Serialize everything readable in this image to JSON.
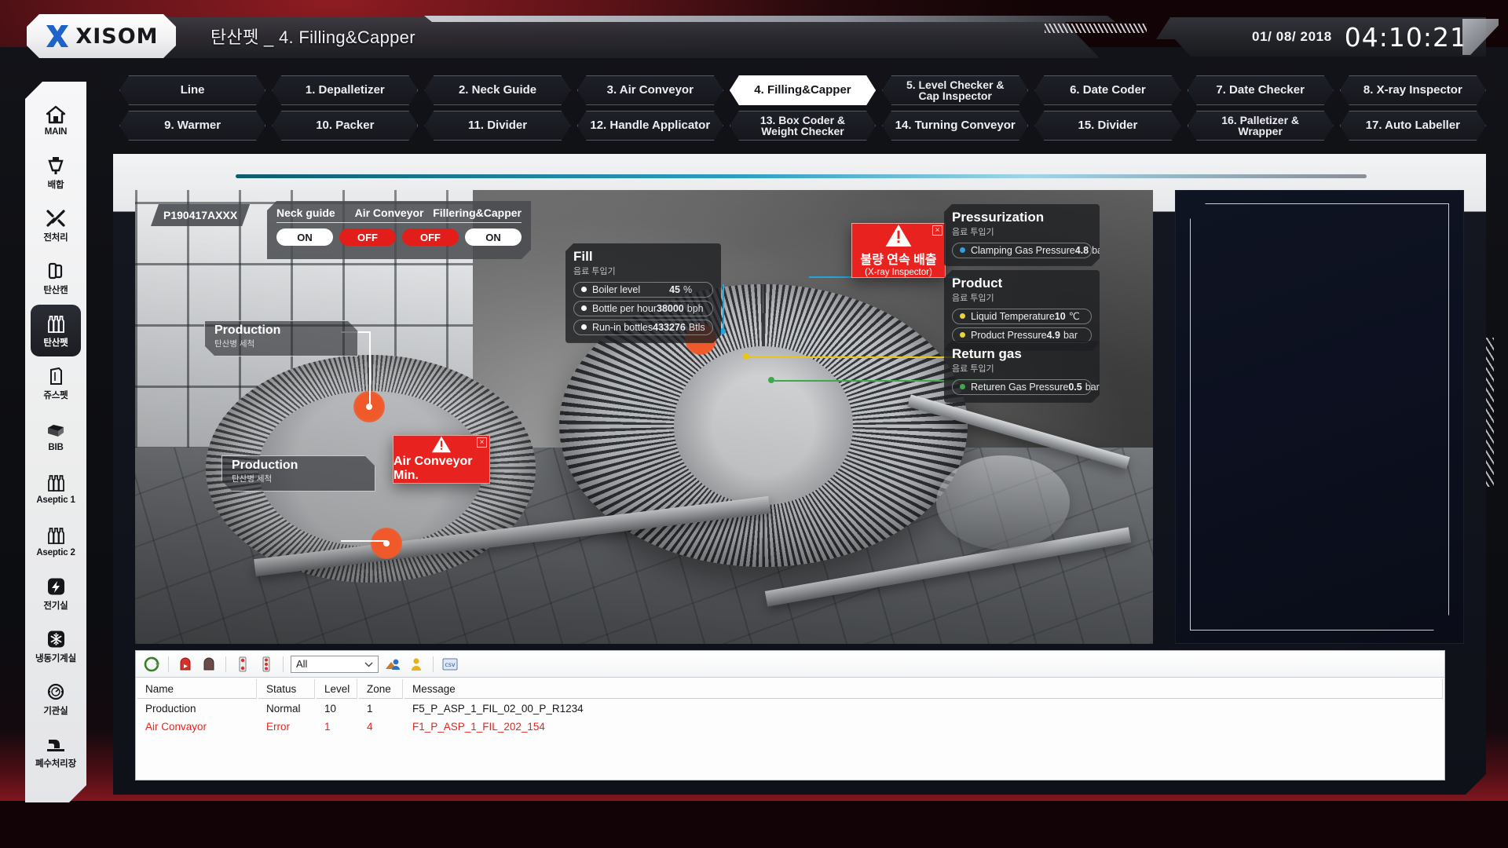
{
  "header": {
    "logo_word": "XISOM",
    "logo_icon": "x-logo-icon",
    "title": "탄산펫 _ 4. Filling&Capper",
    "date": "01/ 08/ 2018",
    "time": "04:10:21"
  },
  "sidebar": {
    "items": [
      {
        "label": "MAIN",
        "icon": "home-icon",
        "active": false
      },
      {
        "label": "배합",
        "icon": "mixer-icon",
        "active": false
      },
      {
        "label": "전처리",
        "icon": "tools-icon",
        "active": false
      },
      {
        "label": "탄산캔",
        "icon": "can-icon",
        "active": false
      },
      {
        "label": "탄산펫",
        "icon": "bottles-icon",
        "active": true
      },
      {
        "label": "쥬스펫",
        "icon": "carton-icon",
        "active": false
      },
      {
        "label": "BIB",
        "icon": "box-icon",
        "active": false
      },
      {
        "label": "Aseptic 1",
        "icon": "bottles-row-icon",
        "active": false
      },
      {
        "label": "Aseptic 2",
        "icon": "bottles-row-icon",
        "active": false
      },
      {
        "label": "전기실",
        "icon": "bolt-icon",
        "active": false
      },
      {
        "label": "냉동기계실",
        "icon": "snowflake-icon",
        "active": false
      },
      {
        "label": "기관실",
        "icon": "gauge-icon",
        "active": false
      },
      {
        "label": "폐수처리장",
        "icon": "waste-water-icon",
        "active": false
      }
    ]
  },
  "tabs": {
    "row1": [
      {
        "label": "Line",
        "active": false
      },
      {
        "label": "1. Depalletizer",
        "active": false
      },
      {
        "label": "2. Neck Guide",
        "active": false
      },
      {
        "label": "3. Air Conveyor",
        "active": false
      },
      {
        "label": "4. Filling&Capper",
        "active": true
      },
      {
        "label": "5. Level Checker &\nCap Inspector",
        "active": false
      },
      {
        "label": "6. Date Coder",
        "active": false
      },
      {
        "label": "7. Date Checker",
        "active": false
      },
      {
        "label": "8. X-ray Inspector",
        "active": false
      }
    ],
    "row2": [
      {
        "label": "9. Warmer",
        "active": false
      },
      {
        "label": "10. Packer",
        "active": false
      },
      {
        "label": "11. Divider",
        "active": false
      },
      {
        "label": "12. Handle Applicator",
        "active": false
      },
      {
        "label": "13. Box Coder &\nWeight Checker",
        "active": false
      },
      {
        "label": "14. Turning Conveyor",
        "active": false
      },
      {
        "label": "15. Divider",
        "active": false
      },
      {
        "label": "16. Palletizer &\nWrapper",
        "active": false
      },
      {
        "label": "17. Auto Labeller",
        "active": false
      }
    ]
  },
  "scene": {
    "product_code": "P190417AXXX",
    "control_panel": {
      "headers": [
        "Neck guide",
        "Air Conveyor",
        "Fillering&Capper"
      ],
      "buttons": [
        {
          "label": "ON",
          "state": "on"
        },
        {
          "label": "OFF",
          "state": "off"
        },
        {
          "label": "OFF",
          "state": "off"
        },
        {
          "label": "ON",
          "state": "on"
        }
      ]
    },
    "callouts": [
      {
        "title": "Production",
        "sub": "탄산병 세척"
      },
      {
        "title": "Production",
        "sub": "탄산병 세척"
      }
    ],
    "alarms": [
      {
        "line1": "불량 연속 배출",
        "line2": "(X-ray Inspector)",
        "close": "×"
      },
      {
        "line1": "Air Conveyor Min.",
        "line2": "",
        "close": "×"
      }
    ],
    "cards": [
      {
        "name": "fill-card",
        "title": "Fill",
        "sub": "음료 투입기",
        "rows": [
          {
            "label": "Boiler level",
            "value": "45",
            "unit": "%",
            "dot": "#ffffff"
          },
          {
            "label": "Bottle per hour",
            "value": "38000",
            "unit": "bph",
            "dot": "#ffffff"
          },
          {
            "label": "Run-in bottles",
            "value": "433276",
            "unit": "Btls",
            "dot": "#ffffff"
          }
        ]
      },
      {
        "name": "pressurization-card",
        "title": "Pressurization",
        "sub": "음료 투입기",
        "rows": [
          {
            "label": "Clamping Gas Pressure",
            "value": "4.8",
            "unit": "bar",
            "dot": "#2f9fe0"
          }
        ]
      },
      {
        "name": "product-card",
        "title": "Product",
        "sub": "음료 투입기",
        "rows": [
          {
            "label": "Liquid Temperature",
            "value": "10",
            "unit": "℃",
            "dot": "#e8d43c"
          },
          {
            "label": "Product Pressure",
            "value": "4.9",
            "unit": "bar",
            "dot": "#e8d43c"
          }
        ]
      },
      {
        "name": "return-gas-card",
        "title": "Return gas",
        "sub": "음료 투입기",
        "rows": [
          {
            "label": "Returen Gas Pressure",
            "value": "0.5",
            "unit": "bar",
            "dot": "#3fa84a"
          }
        ]
      }
    ]
  },
  "log": {
    "toolbar": {
      "icons": [
        "refresh-icon",
        "alarm-active-icon",
        "alarm-off-icon",
        "filter-check-icon",
        "filter-all-icon",
        "group-user-icon",
        "user-alert-icon",
        "csv-export-icon"
      ],
      "filter_value": "All"
    },
    "columns": [
      "Name",
      "Status",
      "Level",
      "Zone",
      "Message"
    ],
    "rows": [
      {
        "name": "Production",
        "status": "Normal",
        "level": "10",
        "zone": "1",
        "message": "F5_P_ASP_1_FIL_02_00_P_R1234",
        "error": false
      },
      {
        "name": "Air Convayor",
        "status": "Error",
        "level": "1",
        "zone": "4",
        "message": "F1_P_ASP_1_FIL_202_154",
        "error": true
      }
    ]
  },
  "colors": {
    "accent_red": "#e8231f",
    "accent_blue": "#2e9fc0",
    "panel_dark": "#1e1f22",
    "tab_active_bg": "#ffffff"
  }
}
